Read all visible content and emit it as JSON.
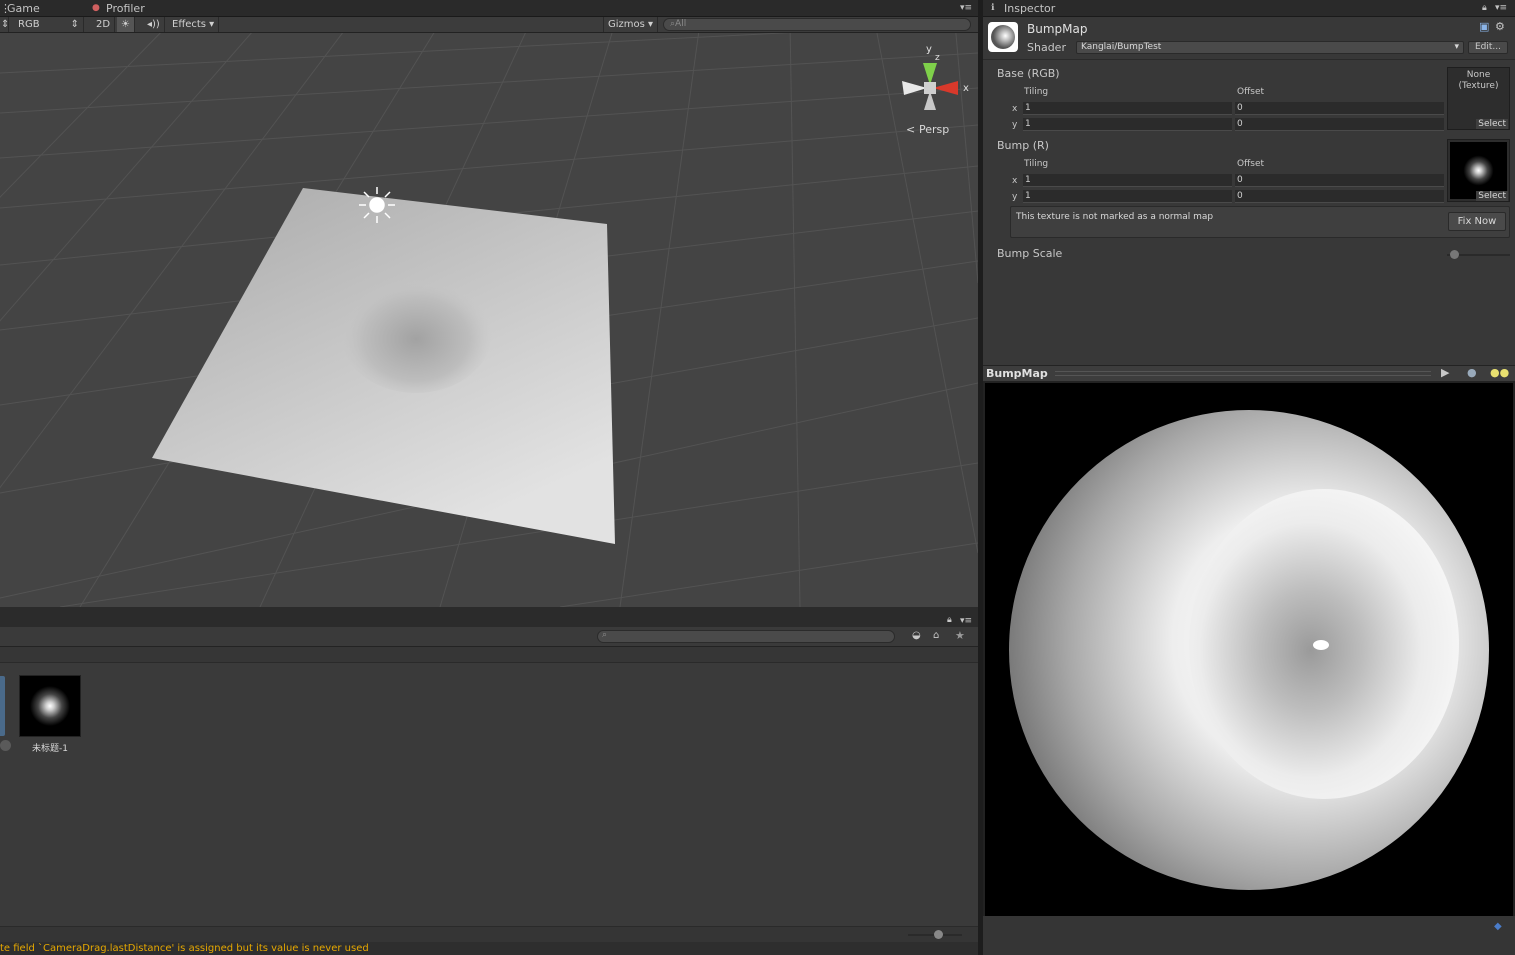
{
  "tabs": {
    "game": "Game",
    "profiler": "Profiler"
  },
  "scene_toolbar": {
    "shading": "RGB",
    "mode_2d": "2D",
    "effects": "Effects",
    "gizmos": "Gizmos",
    "search_placeholder": "All"
  },
  "gizmo": {
    "y": "y",
    "z": "z",
    "x": "x",
    "persp": "Persp"
  },
  "project": {
    "asset_name": "未标题-1"
  },
  "console": {
    "message": "te field `CameraDrag.lastDistance' is assigned but its value is never used"
  },
  "inspector": {
    "tab": "Inspector",
    "material_name": "BumpMap",
    "shader_label": "Shader",
    "shader_value": "Kanglai/BumpTest",
    "edit_button": "Edit...",
    "base": {
      "title": "Base (RGB)",
      "tiling": "Tiling",
      "offset": "Offset",
      "x_label": "x",
      "y_label": "y",
      "tiling_x": "1",
      "tiling_y": "1",
      "offset_x": "0",
      "offset_y": "0",
      "slot_text": "None\n(Texture)",
      "select": "Select"
    },
    "bump": {
      "title": "Bump (R)",
      "tiling": "Tiling",
      "offset": "Offset",
      "x_label": "x",
      "y_label": "y",
      "tiling_x": "1",
      "tiling_y": "1",
      "offset_x": "0",
      "offset_y": "0",
      "select": "Select"
    },
    "warning": "This texture is not marked as a normal map",
    "fix_now": "Fix Now",
    "bump_scale": "Bump Scale",
    "bump_scale_value": 0.05
  },
  "preview": {
    "title": "BumpMap"
  },
  "colors": {
    "accent": "#4a7cc9",
    "warning": "#e6a800",
    "scene_bg": "#444444"
  }
}
